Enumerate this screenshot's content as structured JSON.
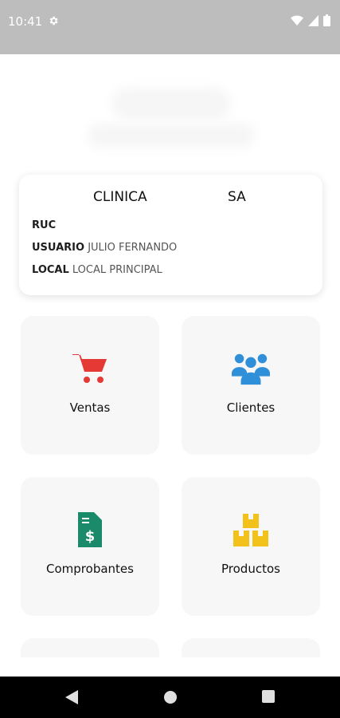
{
  "status": {
    "time": "10:41",
    "icons": [
      "settings-icon",
      "wifi-icon",
      "signal-icon",
      "battery-icon"
    ]
  },
  "company": {
    "name_part1": "CLINICA",
    "name_part2": "SA"
  },
  "info": {
    "ruc_label": "RUC",
    "ruc_value": "",
    "usuario_label": "USUARIO",
    "usuario_value": "JULIO FERNANDO",
    "local_label": "LOCAL",
    "local_value": "LOCAL PRINCIPAL"
  },
  "tiles": [
    {
      "label": "Ventas",
      "icon": "cart-icon",
      "color": "#e53935"
    },
    {
      "label": "Clientes",
      "icon": "users-icon",
      "color": "#2f8fd8"
    },
    {
      "label": "Comprobantes",
      "icon": "receipt-icon",
      "color": "#1b8a6b"
    },
    {
      "label": "Productos",
      "icon": "boxes-icon",
      "color": "#f2c21b"
    }
  ],
  "nav": [
    "back-icon",
    "home-icon",
    "recents-icon"
  ]
}
